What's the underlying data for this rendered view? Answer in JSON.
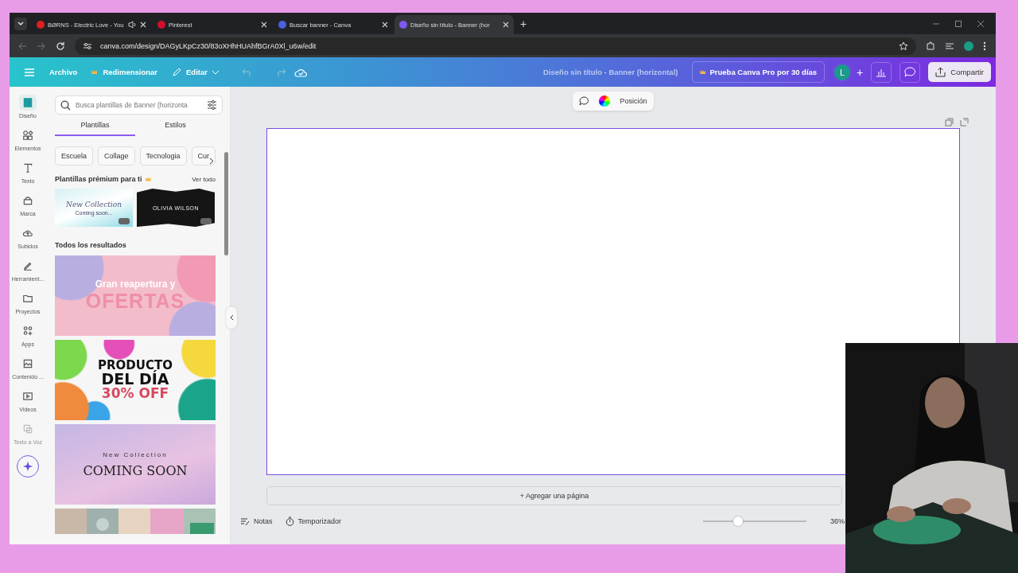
{
  "browser": {
    "tabs": [
      {
        "title": "BØRNS - Electric Love - You",
        "selected": false,
        "audio": true,
        "color": "#e02020"
      },
      {
        "title": "Pinterest",
        "selected": false,
        "audio": false,
        "color": "#d0102c"
      },
      {
        "title": "Buscar banner - Canva",
        "selected": false,
        "audio": false,
        "color": "#4a60e0"
      },
      {
        "title": "Diseño sin título - Banner (hor",
        "selected": true,
        "audio": false,
        "color": "#7a5af0"
      }
    ],
    "new_tab": "+",
    "url": "canva.com/design/DAGyLKpCz30/83oXHhHUAhfBGrA0Xl_u6w/edit"
  },
  "header": {
    "menu": [
      "Archivo",
      "Redimensionar",
      "Editar"
    ],
    "title": "Diseño sin título - Banner (horizontal)",
    "pro": "Prueba Canva Pro por 30 días",
    "avatar": "L",
    "plus": "+",
    "share": "Compartir"
  },
  "sidebar": {
    "items": [
      {
        "label": "Diseño",
        "selected": true,
        "disabled": false
      },
      {
        "label": "Elementos",
        "selected": false,
        "disabled": false
      },
      {
        "label": "Texto",
        "selected": false,
        "disabled": false
      },
      {
        "label": "Marca",
        "selected": false,
        "disabled": false
      },
      {
        "label": "Subidos",
        "selected": false,
        "disabled": false
      },
      {
        "label": "Herramient...",
        "selected": false,
        "disabled": false
      },
      {
        "label": "Proyectos",
        "selected": false,
        "disabled": false
      },
      {
        "label": "Apps",
        "selected": false,
        "disabled": false
      },
      {
        "label": "Contenido ...",
        "selected": false,
        "disabled": false
      },
      {
        "label": "Videos",
        "selected": false,
        "disabled": false
      },
      {
        "label": "Texto a Voz",
        "selected": false,
        "disabled": true
      }
    ]
  },
  "panel": {
    "search": {
      "placeholder": "Busca plantillas de Banner (horizonta"
    },
    "tabs": [
      {
        "label": "Plantillas",
        "selected": true
      },
      {
        "label": "Estilos",
        "selected": false
      }
    ],
    "chips": [
      "Escuela",
      "Collage",
      "Tecnologia",
      "Cur"
    ],
    "premium_heading": "Plantillas prémium para ti",
    "see_all": "Ver todo",
    "premium": [
      {
        "lines": [
          "New Collection",
          "Coming soon..."
        ]
      },
      {
        "lines": [
          "OLIVIA WILSON"
        ]
      }
    ],
    "results_heading": "Todos los resultados",
    "results": [
      {
        "kind": "sale",
        "lines": [
          "Gran reapertura y",
          "OFERTAS"
        ]
      },
      {
        "kind": "product",
        "lines": [
          "PRODUCTO",
          "DEL DÍA",
          "30% OFF"
        ]
      },
      {
        "kind": "coming",
        "lines": [
          "New Collection",
          "COMING SOON"
        ]
      },
      {
        "kind": "picture"
      }
    ]
  },
  "toolbar": {
    "position": "Posición"
  },
  "canvas": {
    "add_page": "+ Agregar una página"
  },
  "footer": {
    "notes": "Notas",
    "timer": "Temporizador",
    "zoom": {
      "level": 0.34
    },
    "zoom_reading": "36%"
  }
}
